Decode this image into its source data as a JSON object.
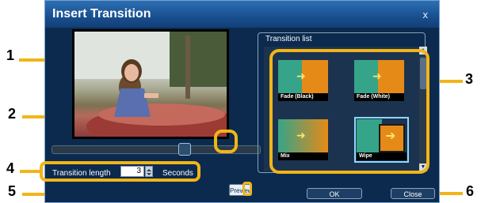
{
  "dialog": {
    "title": "Insert Transition",
    "close_glyph": "x"
  },
  "transition_length": {
    "label": "Transition length",
    "value": "3",
    "unit": "Seconds"
  },
  "buttons": {
    "preview": "Preview",
    "ok": "OK",
    "close": "Close"
  },
  "transition_list": {
    "label": "Transition list",
    "items": [
      {
        "name": "Fade (Black)"
      },
      {
        "name": "Fade (White)"
      },
      {
        "name": "Mix"
      },
      {
        "name": "Wipe"
      }
    ]
  },
  "callouts": [
    "1",
    "2",
    "3",
    "4",
    "5",
    "6"
  ],
  "colors": {
    "callout": "#f2b517",
    "dialog_bg": "#0b2a4e",
    "title_bar": "#2d6fb3"
  }
}
